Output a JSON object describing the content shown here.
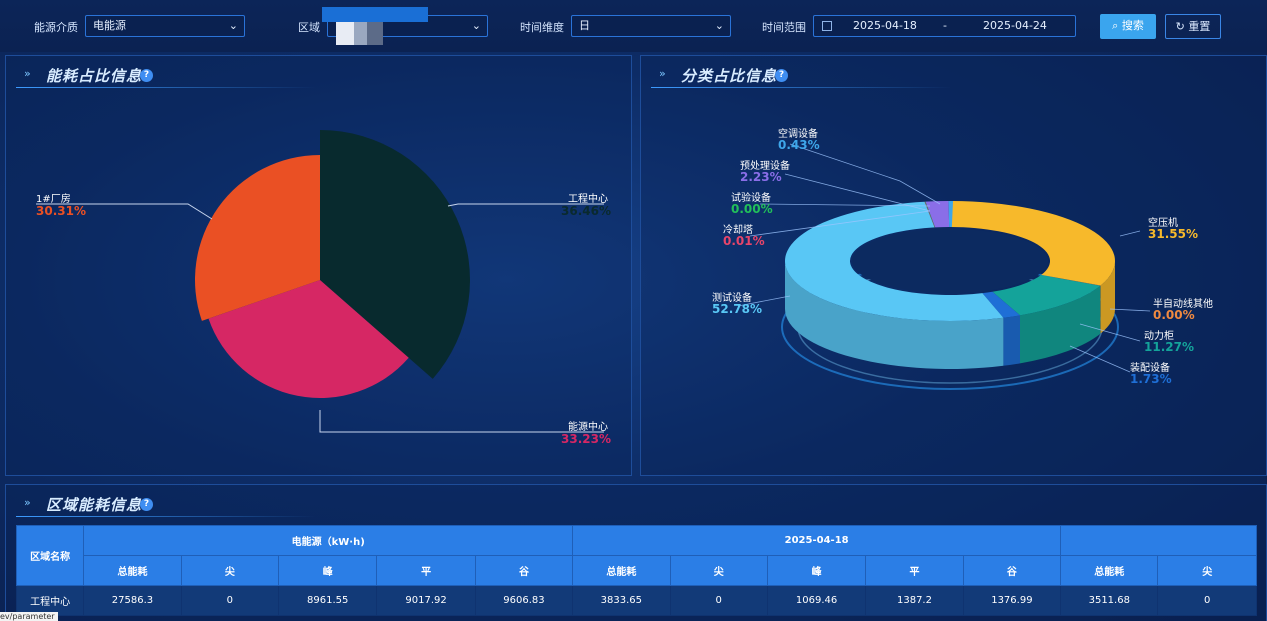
{
  "filters": {
    "energy_label": "能源介质",
    "energy_value": "电能源",
    "area_label": "区域",
    "time_dim_label": "时间维度",
    "time_dim_value": "日",
    "range_label": "时间范围",
    "range_start": "2025-04-18",
    "range_sep": "-",
    "range_end": "2025-04-24",
    "search_label": "搜索",
    "reset_label": "重置"
  },
  "panels": {
    "share_title": "能耗占比信息",
    "category_title": "分类占比信息",
    "region_title": "区域能耗信息"
  },
  "colors": {
    "accent": "#2b7ee6",
    "search_button": "#3aa5ee",
    "table_header": "#2b7ee6",
    "table_row": "#123a78"
  },
  "chart_data": [
    {
      "type": "pie",
      "labels": [
        "工程中心",
        "能源中心",
        "1#厂房"
      ],
      "values": [
        36.46,
        33.23,
        30.31
      ],
      "value_labels": [
        "36.46%",
        "33.23%",
        "30.31%"
      ],
      "colors": [
        "#082a2e",
        "#d62764",
        "#ea5024"
      ]
    },
    {
      "type": "pie",
      "style": "3d-donut",
      "labels": [
        "空压机",
        "半自动线其他",
        "动力柜",
        "装配设备",
        "测试设备",
        "冷却塔",
        "试验设备",
        "预处理设备",
        "空调设备"
      ],
      "values": [
        31.55,
        0.0,
        11.27,
        1.73,
        52.78,
        0.01,
        0.0,
        2.23,
        0.43
      ],
      "value_labels": [
        "31.55%",
        "0.00%",
        "11.27%",
        "1.73%",
        "52.78%",
        "0.01%",
        "0.00%",
        "2.23%",
        "0.43%"
      ],
      "colors": [
        "#f7b92b",
        "#f08a40",
        "#14a39a",
        "#1f6fd6",
        "#59c7f5",
        "#e8456a",
        "#22c05a",
        "#8a6ee8",
        "#3ea6ea"
      ]
    }
  ],
  "table": {
    "region_header": "区域名称",
    "group_headers": [
      "电能源（kW·h)",
      "2025-04-18",
      ""
    ],
    "sub_headers": [
      "总能耗",
      "尖",
      "峰",
      "平",
      "谷",
      "总能耗",
      "尖",
      "峰",
      "平",
      "谷",
      "总能耗",
      "尖"
    ],
    "rows": [
      {
        "name": "工程中心",
        "cells": [
          "27586.3",
          "0",
          "8961.55",
          "9017.92",
          "9606.83",
          "3833.65",
          "0",
          "1069.46",
          "1387.2",
          "1376.99",
          "3511.68",
          "0"
        ]
      }
    ]
  },
  "status_tip": "ev/parameter"
}
